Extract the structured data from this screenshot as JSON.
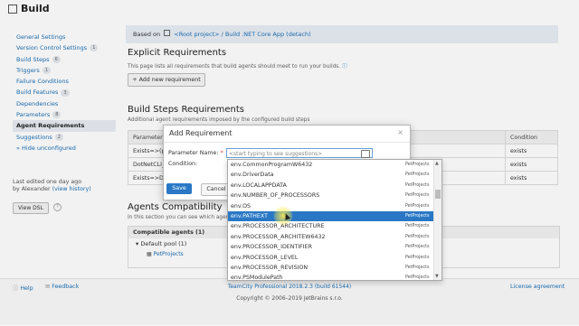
{
  "header": {
    "title": "Build"
  },
  "sidebar": {
    "items": [
      {
        "label": "General Settings",
        "count": ""
      },
      {
        "label": "Version Control Settings",
        "count": "1"
      },
      {
        "label": "Build Steps",
        "count": "6"
      },
      {
        "label": "Triggers",
        "count": "1"
      },
      {
        "label": "Failure Conditions",
        "count": ""
      },
      {
        "label": "Build Features",
        "count": "3"
      },
      {
        "label": "Dependencies",
        "count": ""
      },
      {
        "label": "Parameters",
        "count": "8"
      },
      {
        "label": "Agent Requirements",
        "count": ""
      },
      {
        "label": "Suggestions",
        "count": "2"
      },
      {
        "label": "» Hide unconfigured",
        "count": ""
      }
    ],
    "last_edited": "Last edited one day ago",
    "by": "by Alexander",
    "view_history": "(view history)",
    "view_dsl": "View DSL",
    "help_icon": "?"
  },
  "based_on": {
    "prefix": "Based on",
    "link": "<Root project> / Build .NET Core App (detach)"
  },
  "explicit": {
    "title": "Explicit Requirements",
    "description": "This page lists all requirements that build agents should meet to run your builds.",
    "add_button": "+ Add new requirement"
  },
  "build_steps": {
    "title": "Build Steps Requirements",
    "description": "Additional agent requirements imposed by the configured build steps",
    "header_col1": "Parameter N",
    "header_condition": "Condition",
    "rows": [
      {
        "param": "Exists=>(pc",
        "condition": "exists"
      },
      {
        "param": "DotNetCLI_",
        "condition": "exists"
      },
      {
        "param": "Exists=>Do",
        "condition": "exists"
      }
    ]
  },
  "compat": {
    "title": "Agents Compatibility",
    "description": "In this section you can see which agents ar",
    "compatible_header": "Compatible agents (1)",
    "pool": "Default pool (1)",
    "project": "PetProjects"
  },
  "dialog": {
    "title": "Add Requirement",
    "close": "×",
    "param_label": "Parameter Name:",
    "required_mark": "*",
    "param_placeholder": "<start typing to see suggestions>",
    "condition_label": "Condition:",
    "save": "Save",
    "cancel": "Cancel"
  },
  "suggestions": [
    {
      "name": "env.CommonProgramW6432",
      "project": "PetProjects"
    },
    {
      "name": "env.DriverData",
      "project": "PetProjects"
    },
    {
      "name": "env.LOCALAPPDATA",
      "project": "PetProjects"
    },
    {
      "name": "env.NUMBER_OF_PROCESSORS",
      "project": "PetProjects"
    },
    {
      "name": "env.OS",
      "project": "PetProjects"
    },
    {
      "name": "env.PATHEXT",
      "project": "PetProjects"
    },
    {
      "name": "env.PROCESSOR_ARCHITECTURE",
      "project": "PetProjects"
    },
    {
      "name": "env.PROCESSOR_ARCHITEW6432",
      "project": "PetProjects"
    },
    {
      "name": "env.PROCESSOR_IDENTIFIER",
      "project": "PetProjects"
    },
    {
      "name": "env.PROCESSOR_LEVEL",
      "project": "PetProjects"
    },
    {
      "name": "env.PROCESSOR_REVISION",
      "project": "PetProjects"
    },
    {
      "name": "env.PSModulePath",
      "project": "PetProjects"
    }
  ],
  "selected_suggestion": "env.PATHEXT",
  "footer": {
    "help": "Help",
    "feedback": "Feedback",
    "version": "TeamCity Professional 2018.2.3 (build 61544)",
    "copyright": "Copyright © 2006–2019 JetBrains s.r.o.",
    "license": "License agreement"
  }
}
